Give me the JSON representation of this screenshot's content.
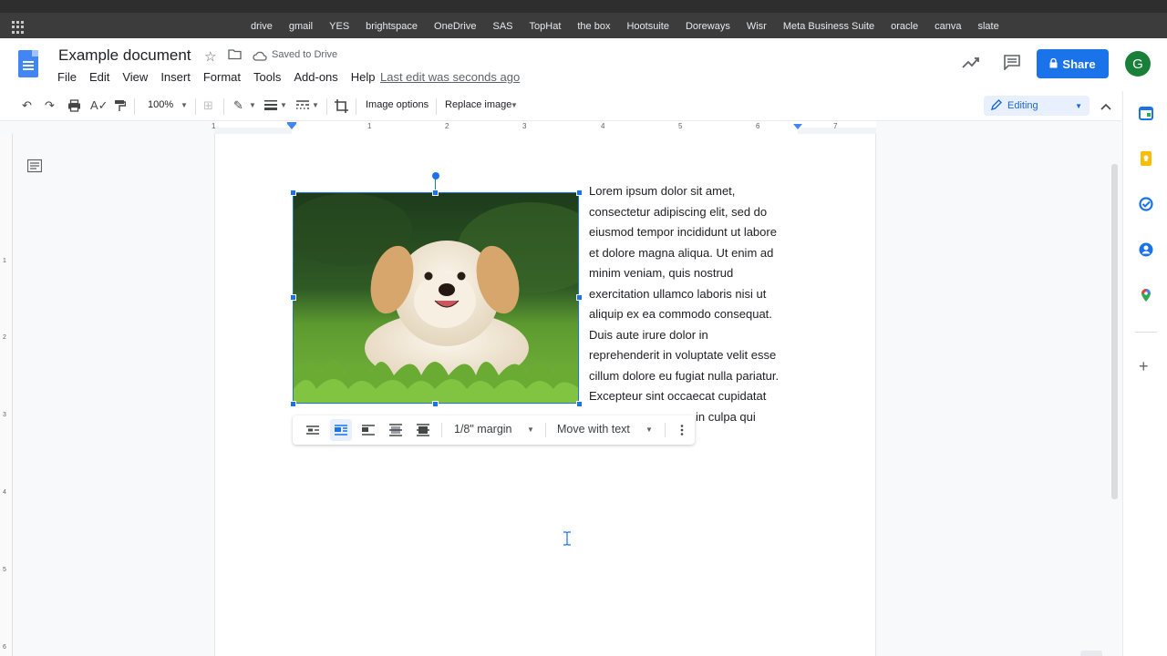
{
  "bookmarks": [
    "drive",
    "gmail",
    "YES",
    "brightspace",
    "OneDrive",
    "SAS",
    "TopHat",
    "the box",
    "Hootsuite",
    "Doreways",
    "Wisr",
    "Meta Business Suite",
    "oracle",
    "canva",
    "slate"
  ],
  "document": {
    "title": "Example document",
    "save_status": "Saved to Drive",
    "last_edit": "Last edit was seconds ago"
  },
  "menu": [
    "File",
    "Edit",
    "View",
    "Insert",
    "Format",
    "Tools",
    "Add-ons",
    "Help"
  ],
  "header": {
    "share_label": "Share",
    "avatar_initial": "G"
  },
  "toolbar": {
    "zoom": "100%",
    "image_options": "Image options",
    "replace_image": "Replace image",
    "mode": "Editing"
  },
  "ruler": {
    "numbers": [
      "1",
      "1",
      "2",
      "3",
      "4",
      "5",
      "6",
      "7"
    ],
    "vertical_numbers": [
      "1",
      "2",
      "3",
      "4",
      "5",
      "6"
    ]
  },
  "body_lines": [
    "Lorem ipsum dolor sit amet,",
    "consectetur adipiscing elit, sed do",
    "eiusmod tempor incididunt ut labore",
    "et dolore magna aliqua. Ut enim ad",
    "minim veniam, quis nostrud",
    "exercitation ullamco laboris nisi ut",
    "aliquip ex ea commodo consequat.",
    "Duis aute irure dolor in",
    "reprehenderit in voluptate velit esse",
    "cillum dolore eu fugiat nulla pariatur.",
    "Excepteur sint occaecat cupidatat",
    "in culpa qui"
  ],
  "image_bar": {
    "margin": "1/8\" margin",
    "position": "Move with text"
  },
  "colors": {
    "accent": "#1a73e8",
    "share": "#1a73e8",
    "avatar": "#188038",
    "docs_blue": "#4285f4"
  }
}
